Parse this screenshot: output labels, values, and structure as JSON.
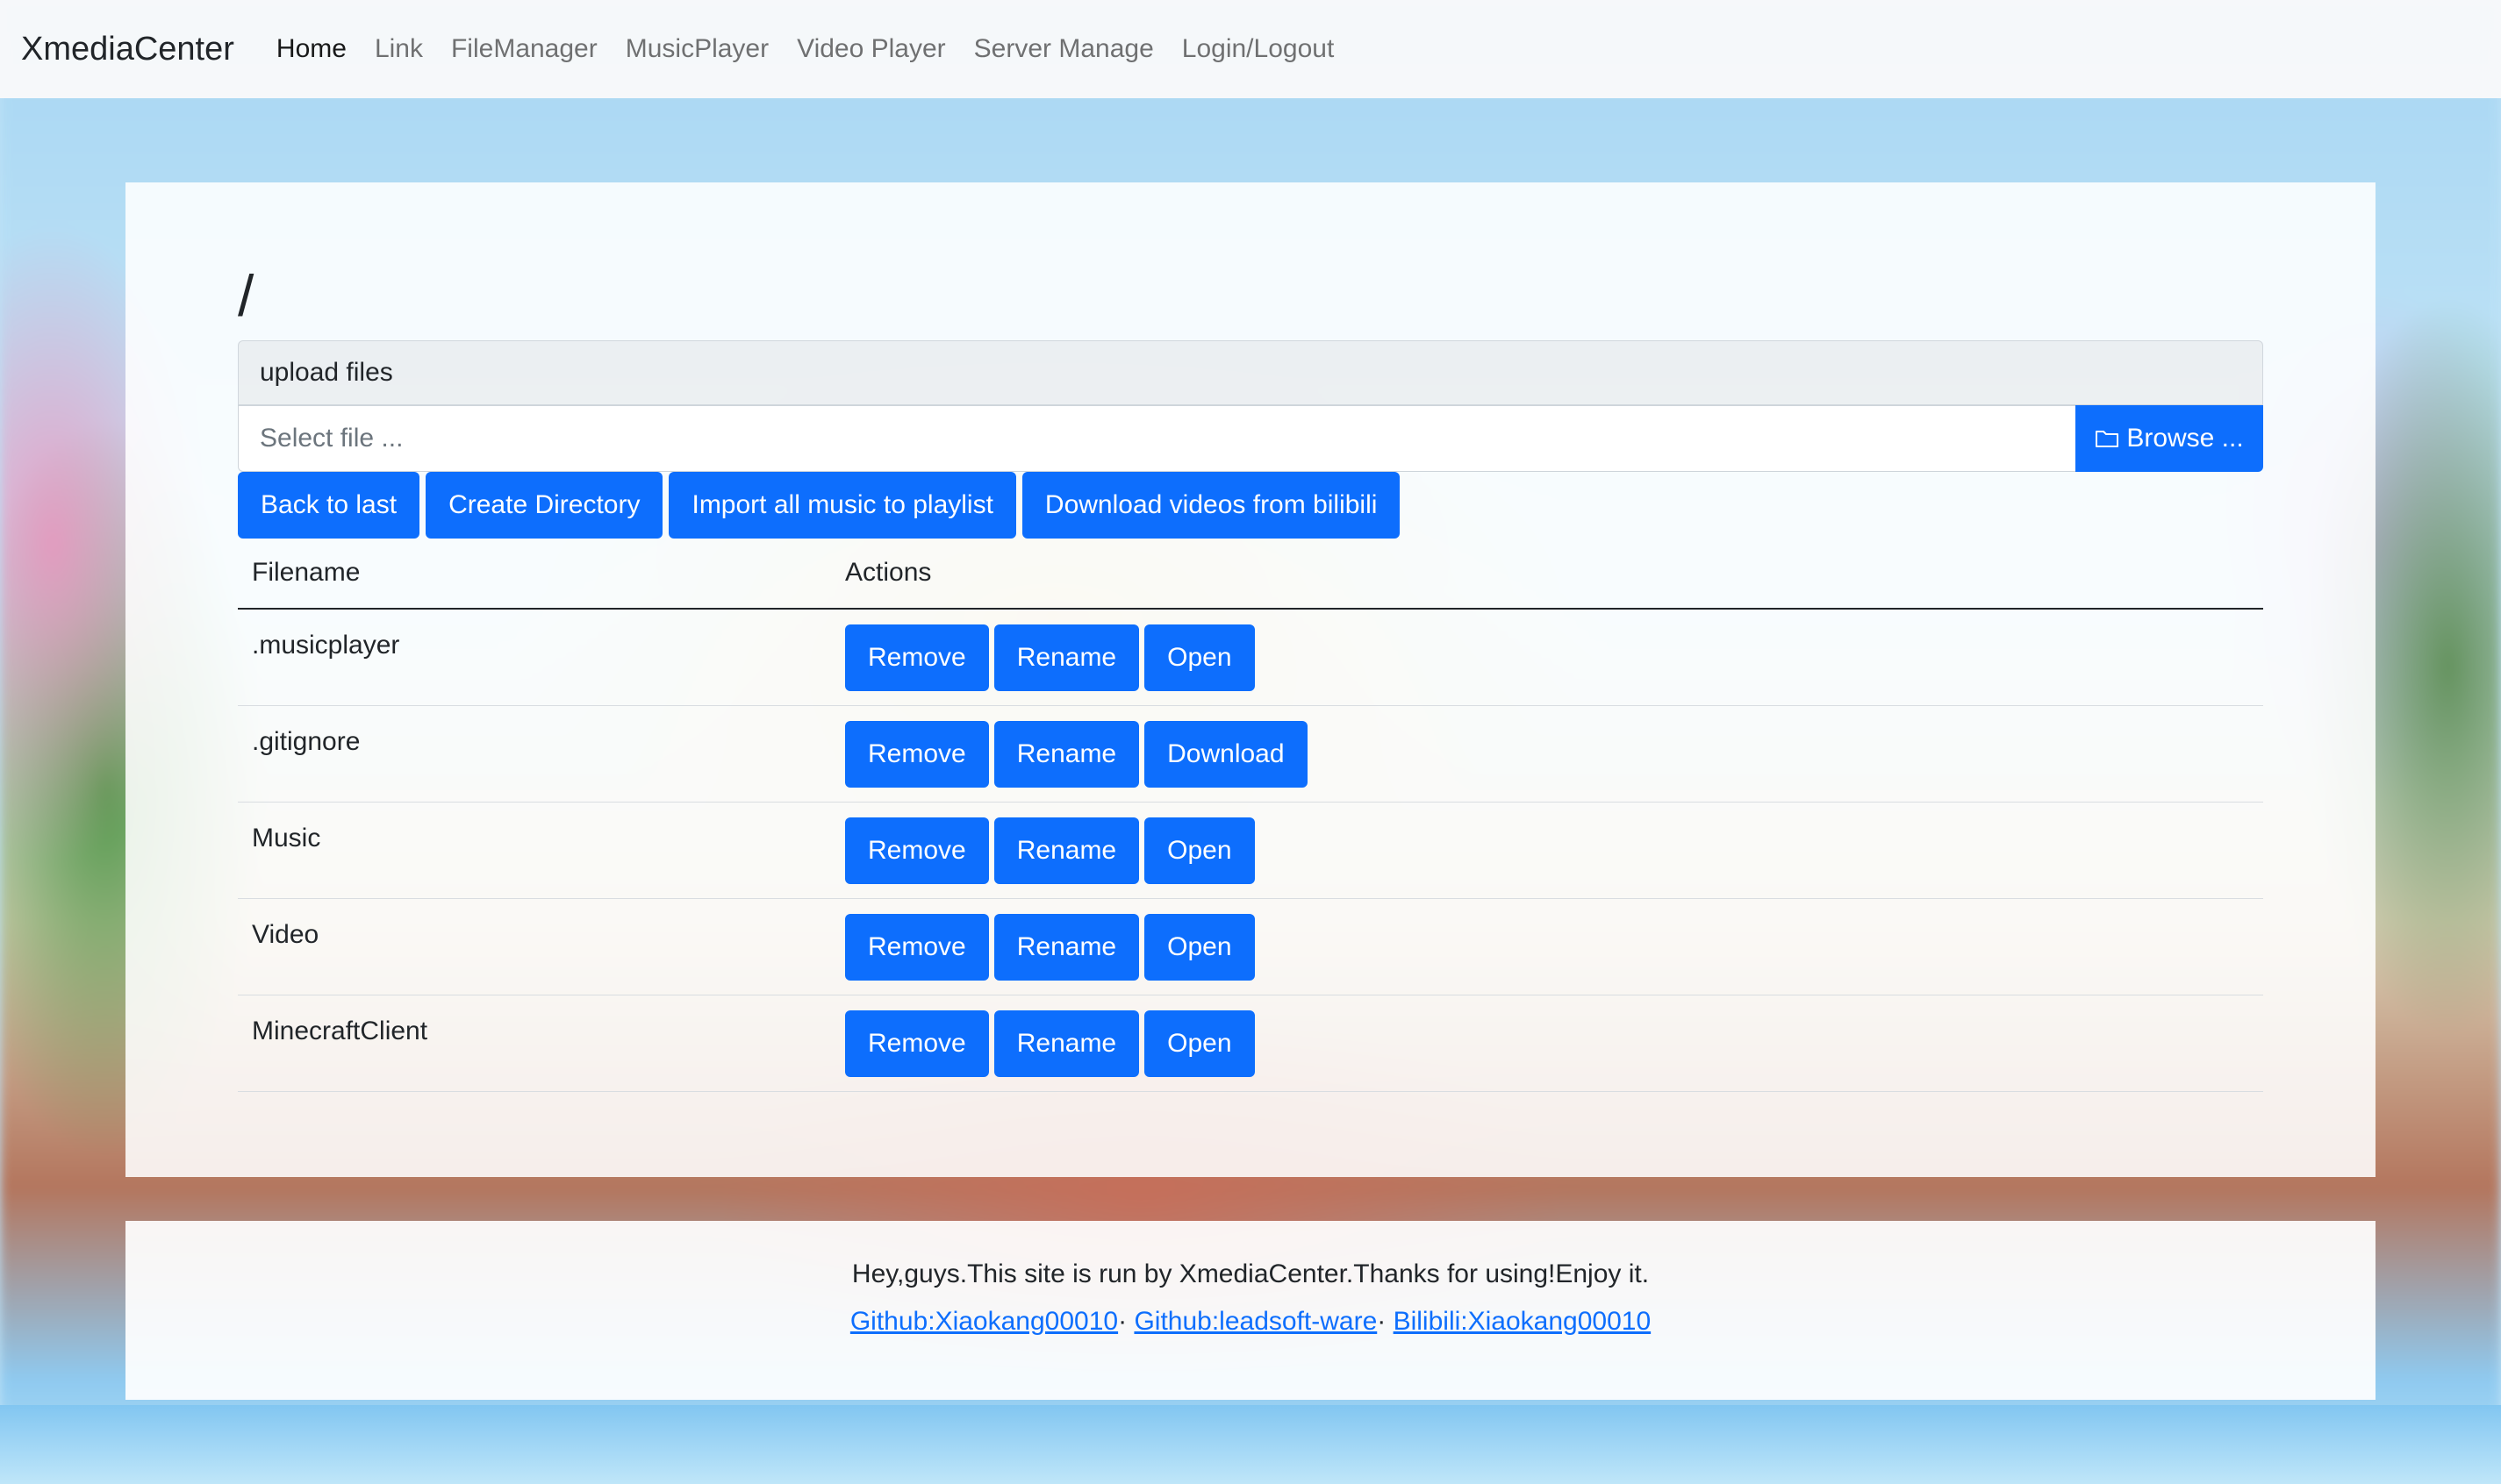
{
  "navbar": {
    "brand": "XmediaCenter",
    "links": [
      "Home",
      "Link",
      "FileManager",
      "MusicPlayer",
      "Video Player",
      "Server Manage",
      "Login/Logout"
    ],
    "active": "Home"
  },
  "file_manager": {
    "path": "/",
    "upload_label": "upload files",
    "file_placeholder": "Select file ...",
    "browse_label": "Browse ...",
    "toolbar": {
      "back": "Back to last",
      "create_dir": "Create Directory",
      "import_music": "Import all music to playlist",
      "download_bilibili": "Download videos from bilibili"
    },
    "table": {
      "headers": [
        "Filename",
        "Actions"
      ],
      "rows": [
        {
          "name": ".musicplayer",
          "actions": [
            "Remove",
            "Rename",
            "Open"
          ]
        },
        {
          "name": ".gitignore",
          "actions": [
            "Remove",
            "Rename",
            "Download"
          ]
        },
        {
          "name": "Music",
          "actions": [
            "Remove",
            "Rename",
            "Open"
          ]
        },
        {
          "name": "Video",
          "actions": [
            "Remove",
            "Rename",
            "Open"
          ]
        },
        {
          "name": "MinecraftClient",
          "actions": [
            "Remove",
            "Rename",
            "Open"
          ]
        }
      ]
    }
  },
  "footer": {
    "text": "Hey,guys.This site is run by XmediaCenter.Thanks for using!Enjoy it.",
    "links": [
      "Github:Xiaokang00010",
      "Github:leadsoft-ware",
      "Bilibili:Xiaokang00010"
    ],
    "separator": "·"
  },
  "colors": {
    "primary": "#0d6efd",
    "navbar_bg": "#f8f9fa"
  },
  "icons": {
    "browse": "folder-icon"
  }
}
